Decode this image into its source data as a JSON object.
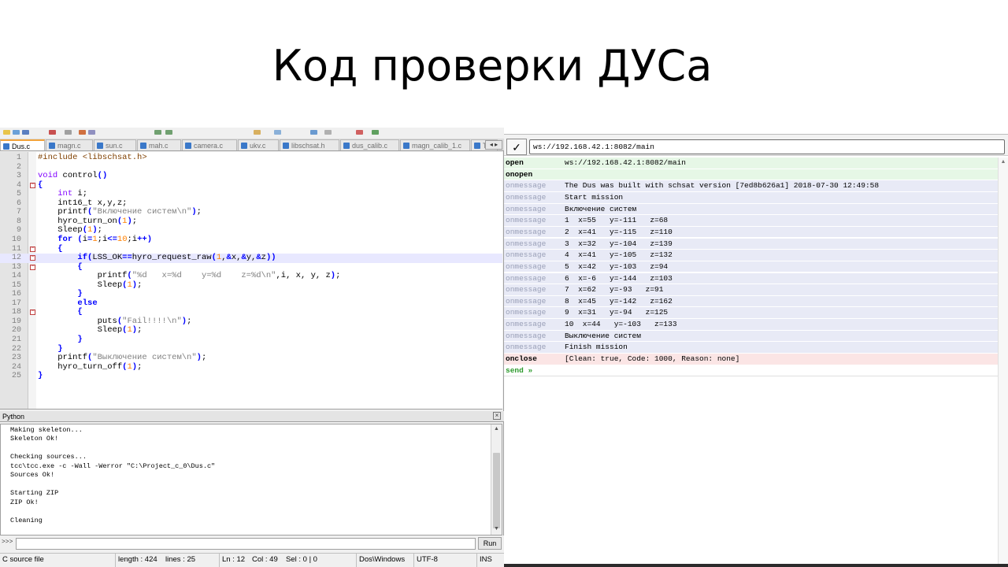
{
  "slide": {
    "title": "Код проверки ДУСа"
  },
  "editor": {
    "tabs": [
      {
        "label": "Dus.c",
        "active": true
      },
      {
        "label": "magn.c"
      },
      {
        "label": "sun.c"
      },
      {
        "label": "mah.c"
      },
      {
        "label": "camera.c"
      },
      {
        "label": "ukv.c"
      },
      {
        "label": "libschsat.h"
      },
      {
        "label": "dus_calib.c"
      },
      {
        "label": "magn_calib_1.c"
      },
      {
        "label": "Ta"
      }
    ],
    "tab_arrows": "◂ ▸",
    "code": [
      {
        "n": "1",
        "html": "<span class=\"pp\">#include &lt;libschsat.h&gt;</span>"
      },
      {
        "n": "2",
        "html": ""
      },
      {
        "n": "3",
        "html": "<span class=\"kt\">void</span> control<span class=\"kw\">()</span>"
      },
      {
        "n": "4",
        "html": "<span class=\"kw\">{</span>",
        "fold": true
      },
      {
        "n": "5",
        "html": "    <span class=\"kt\">int</span> i;"
      },
      {
        "n": "6",
        "html": "    int16_t x,y,z;"
      },
      {
        "n": "7",
        "html": "    printf<span class=\"kw\">(</span><span class=\"str\">\"Включение систем\\n\"</span><span class=\"kw\">)</span>;"
      },
      {
        "n": "8",
        "html": "    hyro_turn_on<span class=\"kw\">(</span><span class=\"num\">1</span><span class=\"kw\">)</span>;"
      },
      {
        "n": "9",
        "html": "    Sleep<span class=\"kw\">(</span><span class=\"num\">1</span><span class=\"kw\">)</span>;"
      },
      {
        "n": "10",
        "html": "    <span class=\"kw\">for (</span>i<span class=\"kw\">=</span><span class=\"num\">1</span>;i<span class=\"kw\">&lt;=</span><span class=\"num\">10</span>;i<span class=\"kw\">++)</span>"
      },
      {
        "n": "11",
        "html": "    <span class=\"kw\">{</span>",
        "fold": true
      },
      {
        "n": "12",
        "html": "        <span class=\"kw\">if(</span>LSS_OK<span class=\"kw\">==</span>hyro_request_raw<span class=\"kw\">(</span><span class=\"num\">1</span>,<span class=\"kw\">&amp;</span>x,<span class=\"kw\">&amp;</span>y,<span class=\"kw\">&amp;</span>z<span class=\"kw\">))</span>",
        "hl": true,
        "fold": true
      },
      {
        "n": "13",
        "html": "        <span class=\"kw\">{</span>",
        "fold": true
      },
      {
        "n": "14",
        "html": "            printf<span class=\"kw\">(</span><span class=\"str\">\"%d   x=%d    y=%d    z=%d\\n\"</span>,i, x, y, z<span class=\"kw\">)</span>;"
      },
      {
        "n": "15",
        "html": "            Sleep<span class=\"kw\">(</span><span class=\"num\">1</span><span class=\"kw\">)</span>;"
      },
      {
        "n": "16",
        "html": "        <span class=\"kw\">}</span>"
      },
      {
        "n": "17",
        "html": "        <span class=\"kw\">else</span>"
      },
      {
        "n": "18",
        "html": "        <span class=\"kw\">{</span>",
        "fold": true
      },
      {
        "n": "19",
        "html": "            puts<span class=\"kw\">(</span><span class=\"str\">\"Fail!!!!\\n\"</span><span class=\"kw\">)</span>;"
      },
      {
        "n": "20",
        "html": "            Sleep<span class=\"kw\">(</span><span class=\"num\">1</span><span class=\"kw\">)</span>;"
      },
      {
        "n": "21",
        "html": "        <span class=\"kw\">}</span>"
      },
      {
        "n": "22",
        "html": "    <span class=\"kw\">}</span>"
      },
      {
        "n": "23",
        "html": "    printf<span class=\"kw\">(</span><span class=\"str\">\"Выключение систем\\n\"</span><span class=\"kw\">)</span>;"
      },
      {
        "n": "24",
        "html": "    hyro_turn_off<span class=\"kw\">(</span><span class=\"num\">1</span><span class=\"kw\">)</span>;"
      },
      {
        "n": "25",
        "html": "<span class=\"kw\">}</span>"
      }
    ],
    "python_panel": {
      "title": "Python",
      "close": "×",
      "lines": [
        "Making skeleton...",
        "Skeleton Ok!",
        "",
        "Checking sources...",
        "tcc\\tcc.exe -c -Wall -Werror \"C:\\Project_c_0\\Dus.c\"",
        "Sources Ok!",
        "",
        "Starting ZIP",
        "ZIP Ok!",
        "",
        "Cleaning"
      ],
      "prompt": ">>>",
      "input_value": "",
      "run_label": "Run"
    },
    "status": {
      "file_type": "C source file",
      "length": "length : 424",
      "lines": "lines : 25",
      "ln": "Ln : 12",
      "col": "Col : 49",
      "sel": "Sel : 0 | 0",
      "eol": "Dos\\Windows",
      "encoding": "UTF-8",
      "mode": "INS"
    }
  },
  "websocket": {
    "check_label": "✓",
    "url": "ws://192.168.42.1:8082/main",
    "log": [
      {
        "type": "open",
        "key": "open",
        "text": "ws://192.168.42.1:8082/main"
      },
      {
        "type": "open",
        "key": "onopen",
        "text": ""
      },
      {
        "type": "msg",
        "key": "onmessage",
        "text": "The Dus was built with schsat version [7ed8b626a1] 2018-07-30 12:49:58"
      },
      {
        "type": "msg",
        "key": "onmessage",
        "text": "Start mission"
      },
      {
        "type": "msg",
        "key": "onmessage",
        "text": "Включение систем"
      },
      {
        "type": "msg",
        "key": "onmessage",
        "text": "1  x=55   y=-111   z=68"
      },
      {
        "type": "msg",
        "key": "onmessage",
        "text": "2  x=41   y=-115   z=110"
      },
      {
        "type": "msg",
        "key": "onmessage",
        "text": "3  x=32   y=-104   z=139"
      },
      {
        "type": "msg",
        "key": "onmessage",
        "text": "4  x=41   y=-105   z=132"
      },
      {
        "type": "msg",
        "key": "onmessage",
        "text": "5  x=42   y=-103   z=94"
      },
      {
        "type": "msg",
        "key": "onmessage",
        "text": "6  x=-6   y=-144   z=103"
      },
      {
        "type": "msg",
        "key": "onmessage",
        "text": "7  x=62   y=-93   z=91"
      },
      {
        "type": "msg",
        "key": "onmessage",
        "text": "8  x=45   y=-142   z=162"
      },
      {
        "type": "msg",
        "key": "onmessage",
        "text": "9  x=31   y=-94   z=125"
      },
      {
        "type": "msg",
        "key": "onmessage",
        "text": "10  x=44   y=-103   z=133"
      },
      {
        "type": "msg",
        "key": "onmessage",
        "text": "Выключение систем"
      },
      {
        "type": "msg",
        "key": "onmessage",
        "text": "Finish mission"
      },
      {
        "type": "close",
        "key": "onclose",
        "text": "[Clean: true, Code: 1000, Reason: none]"
      },
      {
        "type": "send",
        "key": "send »",
        "text": ""
      }
    ]
  }
}
